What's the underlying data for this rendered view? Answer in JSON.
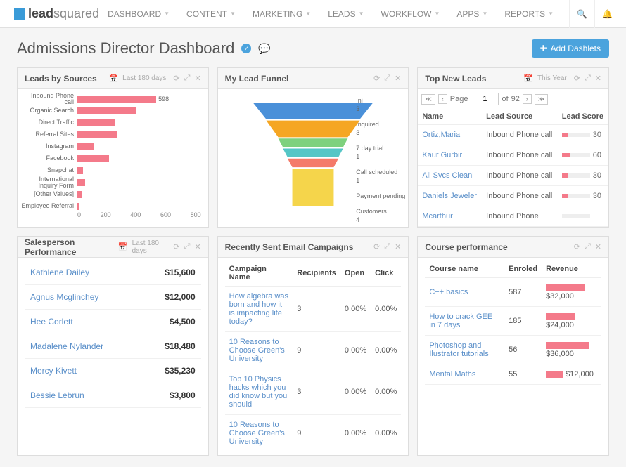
{
  "nav": [
    "DASHBOARD",
    "CONTENT",
    "MARKETING",
    "LEADS",
    "WORKFLOW",
    "APPS",
    "REPORTS"
  ],
  "brand": {
    "bold": "lead",
    "light": "squared"
  },
  "page_title": "Admissions Director Dashboard",
  "add_btn": "Add Dashlets",
  "cards": {
    "sources": {
      "title": "Leads by Sources",
      "date": "Last 180 days"
    },
    "funnel": {
      "title": "My Lead Funnel"
    },
    "newleads": {
      "title": "Top New Leads",
      "date": "This Year"
    },
    "salesperson": {
      "title": "Salesperson Performance",
      "date": "Last 180 days"
    },
    "emails": {
      "title": "Recently Sent Email Campaigns"
    },
    "courses": {
      "title": "Course performance"
    }
  },
  "chart_data": {
    "type": "bar",
    "categories": [
      "Inbound Phone call",
      "Organic Search",
      "Direct Traffic",
      "Referral Sites",
      "Instagram",
      "Facebook",
      "Snapchat",
      "International Inquiry Form",
      "[Other Values]",
      "Employee Referral"
    ],
    "values": [
      598,
      440,
      280,
      300,
      120,
      240,
      40,
      60,
      30,
      10
    ],
    "xlim": [
      0,
      800
    ],
    "xticks": [
      0,
      200,
      400,
      600,
      800
    ],
    "series_color": "#f47a8a"
  },
  "funnel_stages": [
    {
      "label": "Ini",
      "value": 3,
      "color": "#4a90d9"
    },
    {
      "label": "Inquired",
      "value": 3,
      "color": "#f5a623"
    },
    {
      "label": "7 day trial",
      "value": 1,
      "color": "#7ed17e"
    },
    {
      "label": "Call scheduled",
      "value": 1,
      "color": "#55c6c6"
    },
    {
      "label": "Payment pending",
      "value": "",
      "color": "#f47a6a"
    },
    {
      "label": "Customers",
      "value": 4,
      "color": "#f5d54b"
    }
  ],
  "pager": {
    "page": 1,
    "total": 92,
    "label_page": "Page",
    "label_of": "of"
  },
  "leads_cols": [
    "Name",
    "Lead Source",
    "Lead Score"
  ],
  "leads": [
    {
      "name": "Ortiz,Maria",
      "source": "Inbound Phone call",
      "score": 30,
      "w": 8
    },
    {
      "name": "Kaur Gurbir",
      "source": "Inbound Phone call",
      "score": 60,
      "w": 12
    },
    {
      "name": "All Svcs Cleani",
      "source": "Inbound Phone call",
      "score": 30,
      "w": 8
    },
    {
      "name": "Daniels Jeweler",
      "source": "Inbound Phone call",
      "score": 30,
      "w": 8
    },
    {
      "name": "Mcarthur",
      "source": "Inbound Phone",
      "score": "",
      "w": 0
    }
  ],
  "salespeople": [
    {
      "name": "Kathlene Dailey",
      "amount": "$15,600"
    },
    {
      "name": "Agnus Mcglinchey",
      "amount": "$12,000"
    },
    {
      "name": "Hee Corlett",
      "amount": "$4,500"
    },
    {
      "name": "Madalene Nylander",
      "amount": "$18,480"
    },
    {
      "name": "Mercy Kivett",
      "amount": "$35,230"
    },
    {
      "name": "Bessie Lebrun",
      "amount": "$3,800"
    }
  ],
  "email_cols": [
    "Campaign Name",
    "Recipients",
    "Open",
    "Click"
  ],
  "emails": [
    {
      "name": "How algebra was born and how it is impacting life today?",
      "r": 3,
      "o": "0.00%",
      "c": "0.00%"
    },
    {
      "name": "10 Reasons to Choose Green's University",
      "r": 9,
      "o": "0.00%",
      "c": "0.00%"
    },
    {
      "name": "Top 10 Physics hacks which you did know but you should",
      "r": 3,
      "o": "0.00%",
      "c": "0.00%"
    },
    {
      "name": "10 Reasons to Choose Green's University",
      "r": 9,
      "o": "0.00%",
      "c": "0.00%"
    }
  ],
  "course_cols": [
    "Course name",
    "Enroled",
    "Revenue"
  ],
  "courses": [
    {
      "name": "C++ basics",
      "enrolled": 587,
      "rev": "$32,000",
      "w": 55
    },
    {
      "name": "How to crack GEE in 7 days",
      "enrolled": 185,
      "rev": "$24,000",
      "w": 42
    },
    {
      "name": "Photoshop and Ilustrator tutorials",
      "enrolled": 56,
      "rev": "$36,000",
      "w": 62
    },
    {
      "name": "Mental Maths",
      "enrolled": 55,
      "rev": "$12,000",
      "w": 25
    }
  ]
}
